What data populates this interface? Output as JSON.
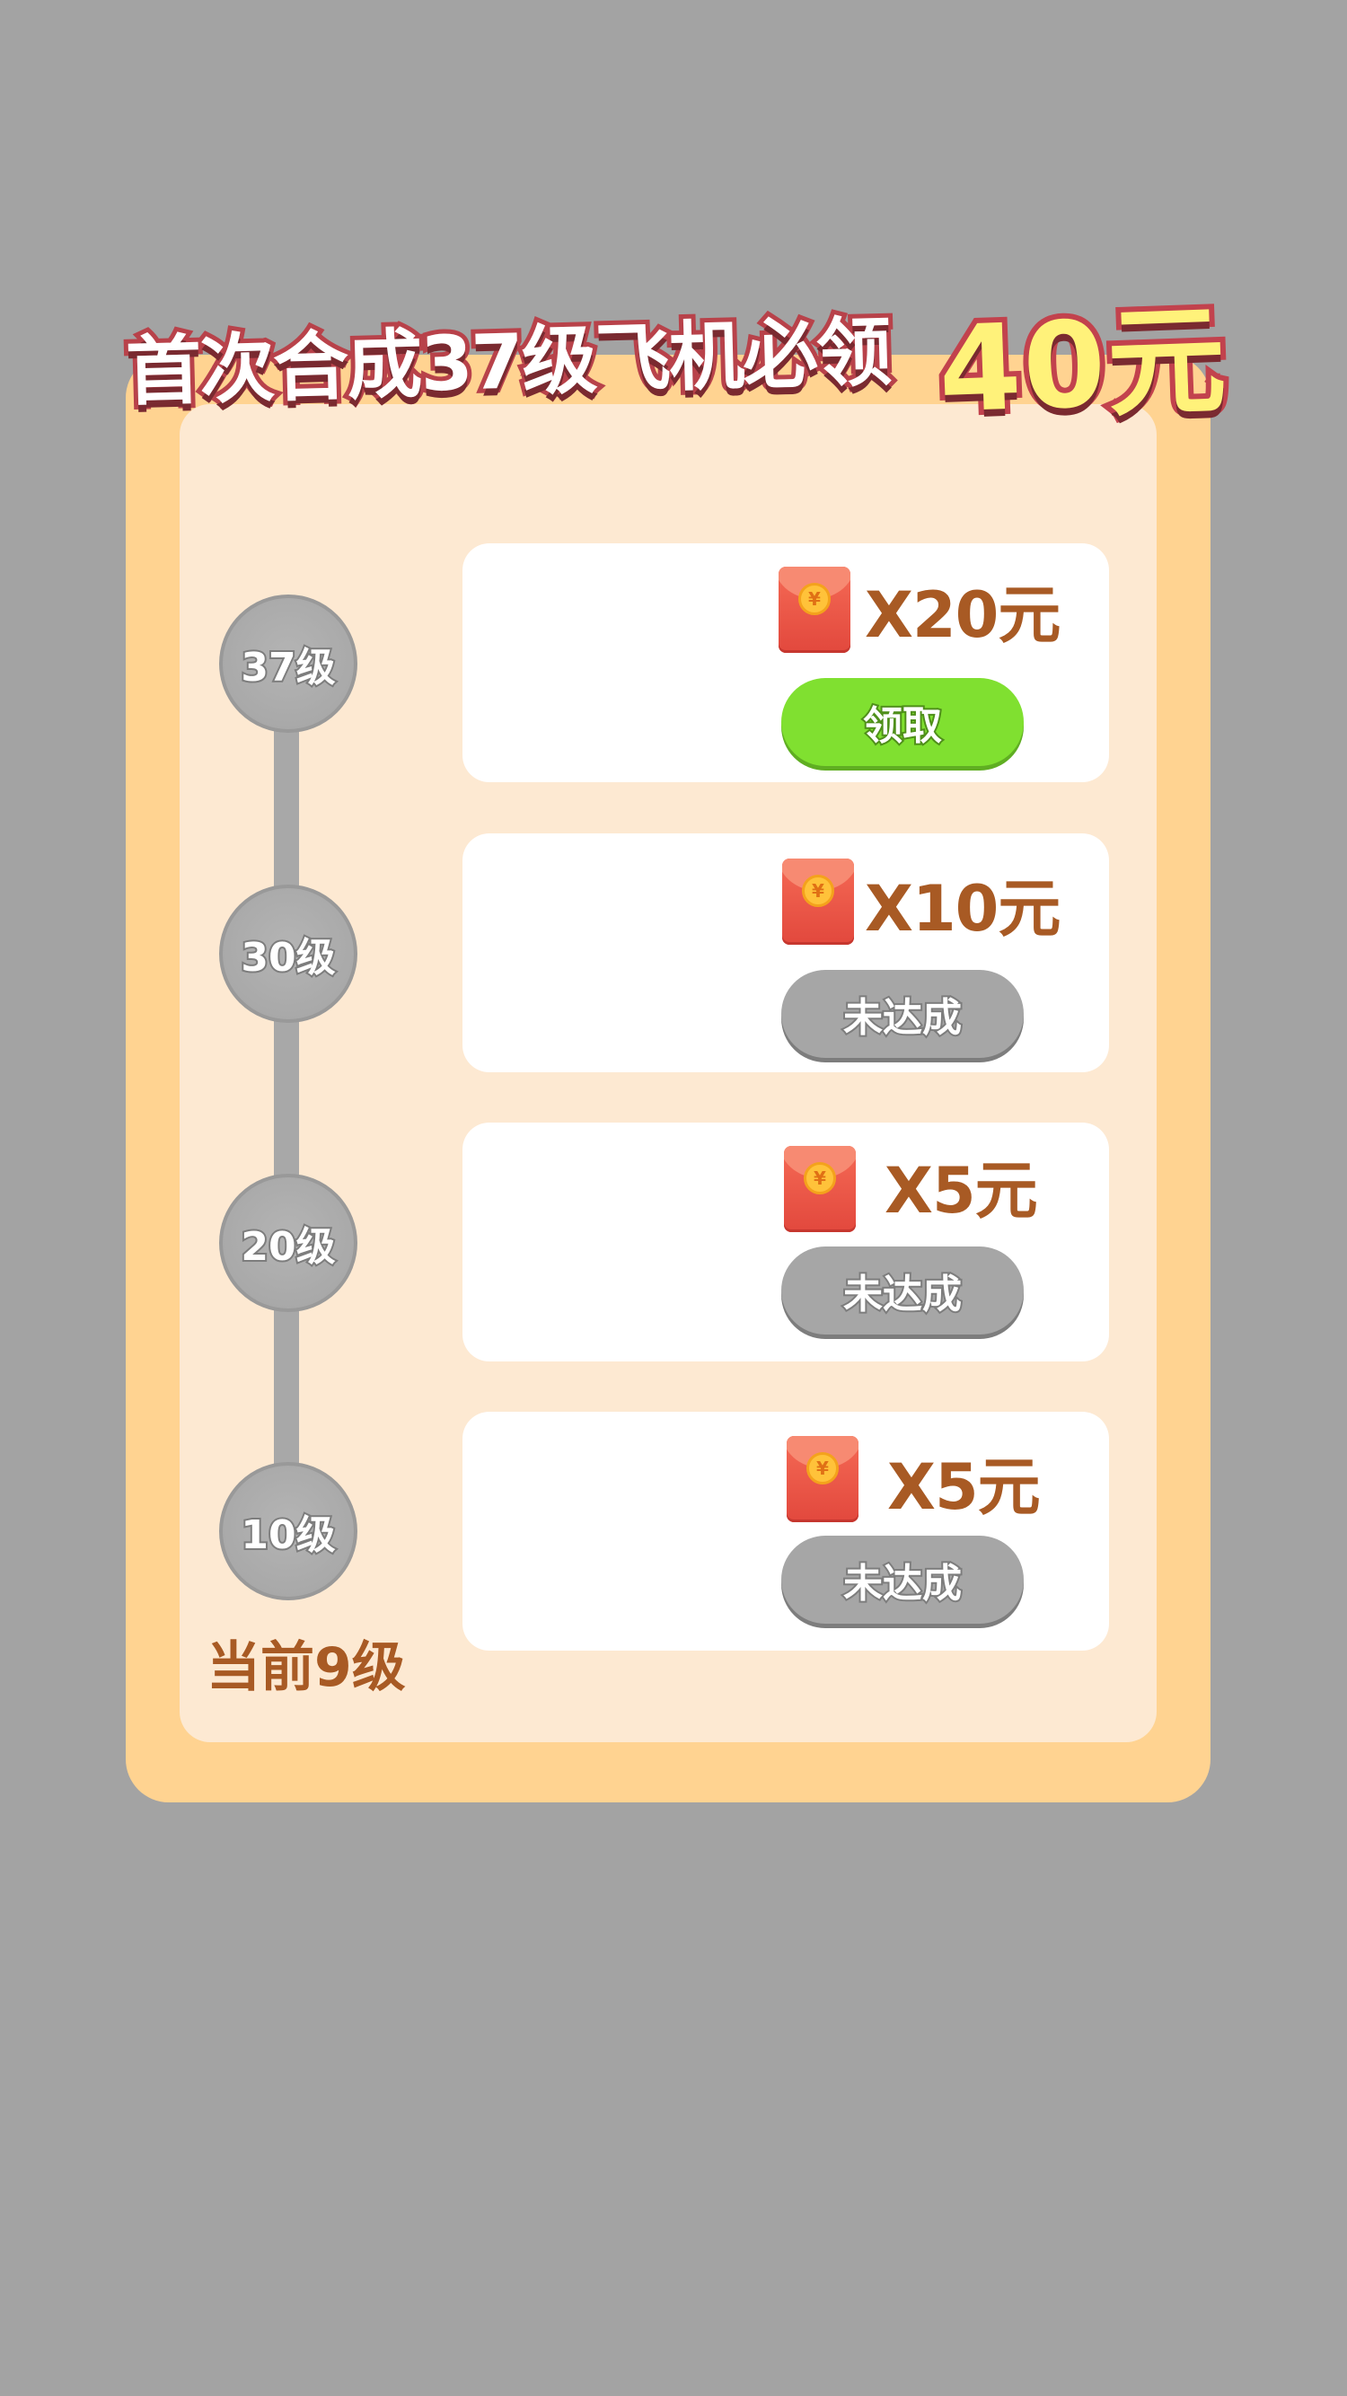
{
  "title": {
    "text": "首次合成37级飞机必领",
    "amount": "40元"
  },
  "levels": [
    {
      "label": "37级"
    },
    {
      "label": "30级"
    },
    {
      "label": "20级"
    },
    {
      "label": "10级"
    }
  ],
  "current_level": "当前9级",
  "rewards": [
    {
      "amount": "X20元",
      "button": "领取",
      "status": "claimable"
    },
    {
      "amount": "X10元",
      "button": "未达成",
      "status": "locked"
    },
    {
      "amount": "X5元",
      "button": "未达成",
      "status": "locked"
    },
    {
      "amount": "X5元",
      "button": "未达成",
      "status": "locked"
    }
  ],
  "icons": {
    "envelope": "red-envelope-icon",
    "coin_symbol": "¥"
  },
  "colors": {
    "background": "#a3a3a3",
    "outer_panel": "#ffd391",
    "inner_panel": "#fde9d2",
    "amount_text": "#a85a24",
    "claim_button": "#80e030",
    "locked_button": "#a6a6a6",
    "title_amount": "#fff27a"
  }
}
